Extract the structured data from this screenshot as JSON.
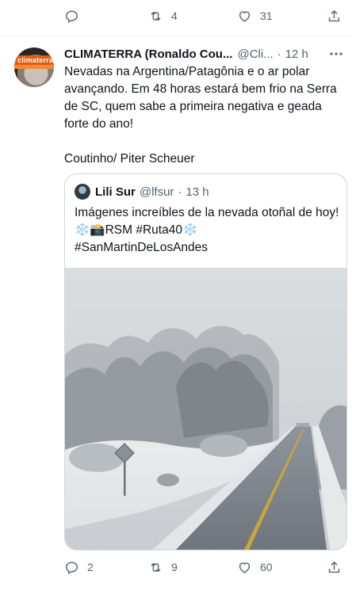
{
  "top_actions": {
    "reply_count": "",
    "retweet_count": "4",
    "like_count": "31"
  },
  "tweet": {
    "author_name": "CLIMATERRA (Ronaldo Cou...",
    "author_handle": "@Cli...",
    "separator": "·",
    "time": "12 h",
    "avatar_logo_text": "climaterra",
    "paragraphs": [
      "Nevadas na Argentina/Patagônia e o ar polar avançando. Em 48 horas estará bem frio na Serra de SC, quem sabe a primeira negativa e geada forte do ano!",
      "Coutinho/ Piter Scheuer"
    ],
    "quote": {
      "author_name": "Lili Sur",
      "author_handle": "@lfsur",
      "separator": "·",
      "time": "13 h",
      "lines": [
        "Imágenes increíbles de la nevada otoñal de hoy!",
        "❄️📸RSM #Ruta40❄️",
        "#SanMartinDeLosAndes"
      ],
      "image_icon": "snowy-road-photo"
    },
    "actions": {
      "reply_count": "2",
      "retweet_count": "9",
      "like_count": "60"
    }
  },
  "icons": {
    "reply": "reply-icon",
    "retweet": "retweet-icon",
    "like": "heart-icon",
    "share": "share-icon",
    "more": "more-icon"
  },
  "colors": {
    "text": "#0f1419",
    "secondary": "#536471",
    "border": "#cfd9de",
    "brand_orange": "#e45c12"
  }
}
